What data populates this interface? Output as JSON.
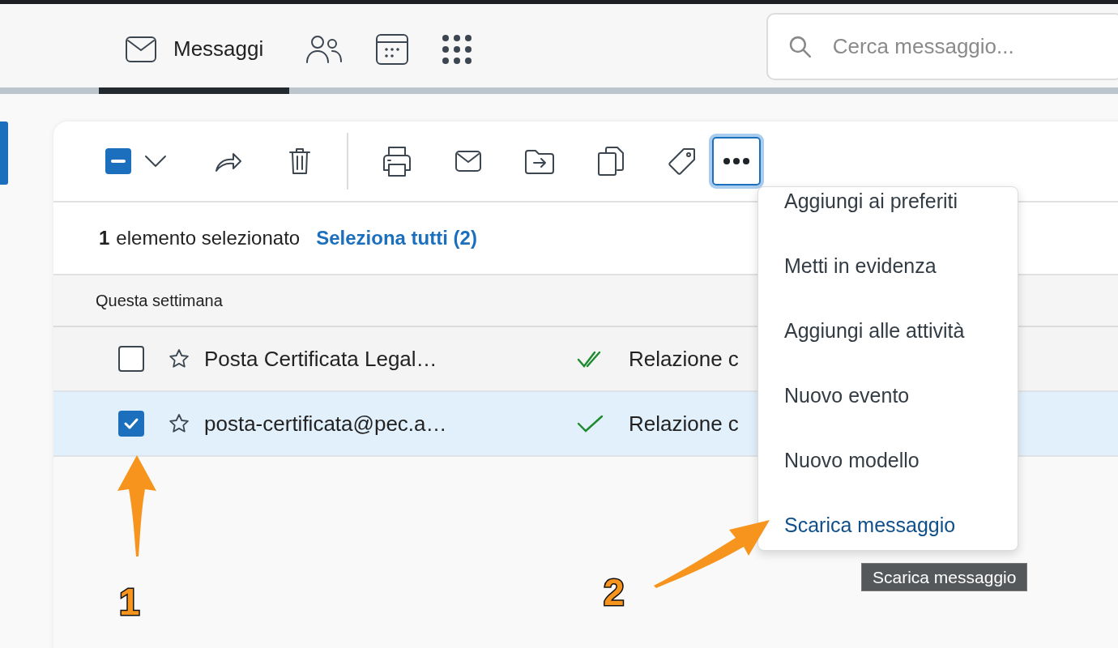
{
  "nav": {
    "tabs": [
      {
        "kind": "mail",
        "label": "Messaggi",
        "selected": true
      },
      {
        "kind": "contacts",
        "selected": false
      },
      {
        "kind": "calendar",
        "selected": false
      },
      {
        "kind": "apps",
        "selected": false
      }
    ]
  },
  "search": {
    "placeholder": "Cerca messaggio..."
  },
  "toolbar": {
    "select_all": {
      "indeterminate": true
    },
    "more_button": {
      "focused": true
    }
  },
  "selection_bar": {
    "count": "1",
    "text": "elemento selezionato",
    "select_all_link": "Seleziona tutti (2)"
  },
  "group": {
    "title": "Questa settimana"
  },
  "messages": [
    {
      "checked": false,
      "selected": false,
      "sender": "Posta Certificata Legal…",
      "double_check": true,
      "subject": "Relazione c"
    },
    {
      "checked": true,
      "selected": true,
      "sender": "posta-certificata@pec.a…",
      "double_check": false,
      "subject": "Relazione c"
    }
  ],
  "menu": {
    "items": [
      {
        "label": "Aggiungi ai preferiti",
        "selected": false
      },
      {
        "label": "Metti in evidenza",
        "selected": false
      },
      {
        "label": "Aggiungi alle attività",
        "selected": false
      },
      {
        "label": "Nuovo evento",
        "selected": false
      },
      {
        "label": "Nuovo modello",
        "selected": false
      },
      {
        "label": "Scarica messaggio",
        "selected": true
      }
    ]
  },
  "tooltip": {
    "text": "Scarica messaggio"
  },
  "annotations": [
    {
      "label": "1"
    },
    {
      "label": "2"
    }
  ]
}
